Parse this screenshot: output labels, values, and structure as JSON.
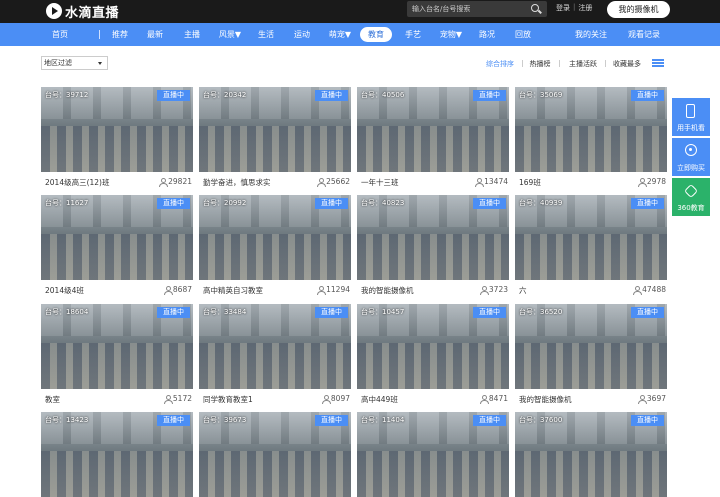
{
  "header": {
    "logo_text": "水滴直播",
    "search_placeholder": "输入台名/台号搜索",
    "login": "登录",
    "divider": "|",
    "register": "注册",
    "my_camera": "我的摄像机"
  },
  "nav": {
    "home": "首页",
    "items": [
      "推荐",
      "最新",
      "主播",
      "风景▼",
      "生活",
      "运动",
      "萌宠▼",
      "教育",
      "手艺",
      "宠物▼",
      "路况",
      "回放"
    ],
    "active": "教育",
    "my_follow": "我的关注",
    "history": "观看记录"
  },
  "filter": {
    "region": "地区过滤"
  },
  "sort": [
    "综合排序",
    "热播榜",
    "主播活跃",
    "收藏最多"
  ],
  "sort_active": "综合排序",
  "live_badge": "直播中",
  "cards": [
    {
      "id": "台号：39712",
      "title": "2014级高三(12)班",
      "viewers": "29821"
    },
    {
      "id": "台号：20342",
      "title": "勤学奋进，慎思求实",
      "viewers": "25662"
    },
    {
      "id": "台号：40506",
      "title": "一年十三班",
      "viewers": "13474"
    },
    {
      "id": "台号：35069",
      "title": "169班",
      "viewers": "2978"
    },
    {
      "id": "台号：11627",
      "title": "2014级4班",
      "viewers": "8687"
    },
    {
      "id": "台号：20992",
      "title": "高中精英自习教室",
      "viewers": "11294"
    },
    {
      "id": "台号：40823",
      "title": "我的智能摄像机",
      "viewers": "3723"
    },
    {
      "id": "台号：40939",
      "title": "六",
      "viewers": "47488"
    },
    {
      "id": "台号：18604",
      "title": "教室",
      "viewers": "5172"
    },
    {
      "id": "台号：33484",
      "title": "同学教育教室1",
      "viewers": "8097"
    },
    {
      "id": "台号：10457",
      "title": "高中449班",
      "viewers": "8471"
    },
    {
      "id": "台号：36520",
      "title": "我的智能摄像机",
      "viewers": "3697"
    },
    {
      "id": "台号：13423",
      "title": "",
      "viewers": ""
    },
    {
      "id": "台号：39673",
      "title": "",
      "viewers": ""
    },
    {
      "id": "台号：11404",
      "title": "",
      "viewers": ""
    },
    {
      "id": "台号：37600",
      "title": "",
      "viewers": ""
    }
  ],
  "side": {
    "phone": "用手机看",
    "buy": "立即购买",
    "edu": "360教育"
  },
  "colors": {
    "accent": "#4b8ef5",
    "topbar": "#1a1a1a",
    "green": "#2bb26a"
  }
}
